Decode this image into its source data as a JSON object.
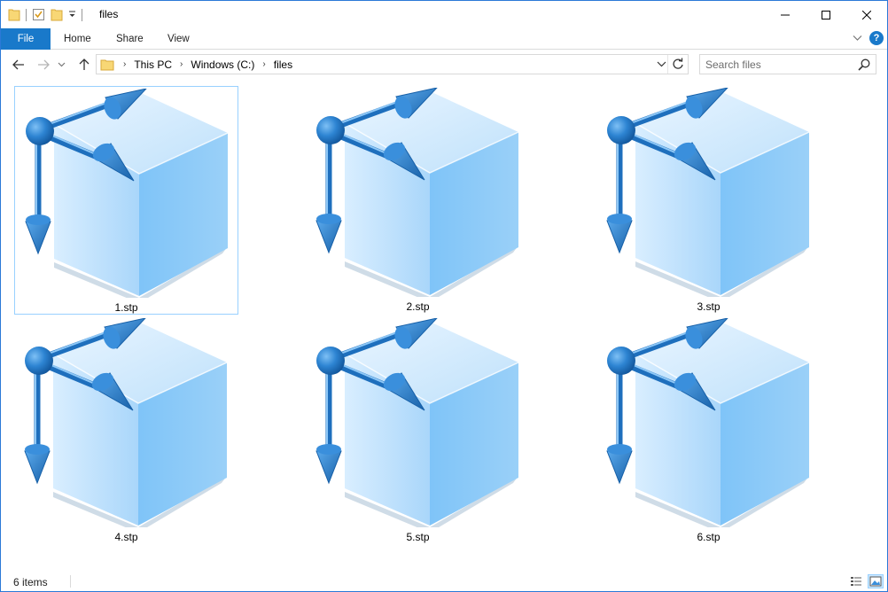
{
  "window": {
    "title": "files"
  },
  "ribbon": {
    "tabs": [
      {
        "label": "File"
      },
      {
        "label": "Home"
      },
      {
        "label": "Share"
      },
      {
        "label": "View"
      }
    ]
  },
  "address": {
    "crumbs": [
      "This PC",
      "Windows (C:)",
      "files"
    ]
  },
  "search": {
    "placeholder": "Search files"
  },
  "files": [
    {
      "name": "1.stp",
      "selected": true
    },
    {
      "name": "2.stp",
      "selected": false
    },
    {
      "name": "3.stp",
      "selected": false
    },
    {
      "name": "4.stp",
      "selected": false
    },
    {
      "name": "5.stp",
      "selected": false
    },
    {
      "name": "6.stp",
      "selected": false
    }
  ],
  "status": {
    "item_count": "6 items"
  },
  "colors": {
    "accent": "#1979ca",
    "selection_border": "#99d1ff",
    "window_border": "#2b79d7"
  },
  "icons": {
    "file_thumbnail": "stp-cube-icon",
    "folder": "folder-icon",
    "back": "back-arrow-icon",
    "forward": "forward-arrow-icon",
    "up": "up-arrow-icon",
    "refresh": "refresh-icon",
    "search": "search-icon"
  }
}
